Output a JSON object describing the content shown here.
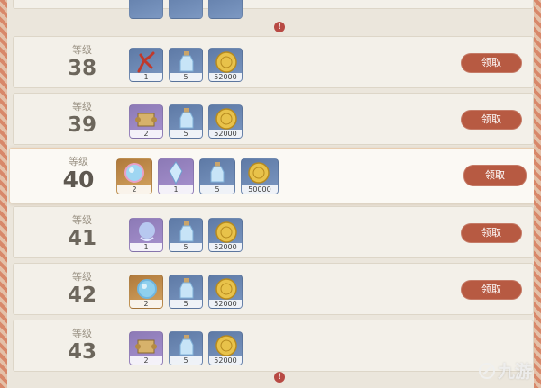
{
  "level_label": "等级",
  "claim_label": "领取",
  "rows": [
    {
      "level": "38",
      "items": [
        {
          "icon": "red-coral-icon",
          "quality": "blue",
          "count": "1"
        },
        {
          "icon": "potion-bottle-icon",
          "quality": "blue",
          "count": "5"
        },
        {
          "icon": "mora-coin-icon",
          "quality": "blue",
          "count": "52000"
        }
      ],
      "claimable": true
    },
    {
      "level": "39",
      "items": [
        {
          "icon": "scroll-icon",
          "quality": "purple",
          "count": "2"
        },
        {
          "icon": "potion-bottle-icon",
          "quality": "blue",
          "count": "5"
        },
        {
          "icon": "mora-coin-icon",
          "quality": "blue",
          "count": "52000"
        }
      ],
      "claimable": true
    },
    {
      "level": "40",
      "items": [
        {
          "icon": "crystal-orb-icon",
          "quality": "gold",
          "count": "2"
        },
        {
          "icon": "crystal-shard-icon",
          "quality": "purple",
          "count": "1"
        },
        {
          "icon": "potion-bottle-icon",
          "quality": "blue",
          "count": "5"
        },
        {
          "icon": "mora-coin-icon",
          "quality": "blue",
          "count": "50000"
        }
      ],
      "claimable": true
    },
    {
      "level": "41",
      "items": [
        {
          "icon": "crescent-orb-icon",
          "quality": "purple",
          "count": "1"
        },
        {
          "icon": "potion-bottle-icon",
          "quality": "blue",
          "count": "5"
        },
        {
          "icon": "mora-coin-icon",
          "quality": "blue",
          "count": "52000"
        }
      ],
      "claimable": true
    },
    {
      "level": "42",
      "items": [
        {
          "icon": "crystal-orb-icon",
          "quality": "gold",
          "count": "2"
        },
        {
          "icon": "potion-bottle-icon",
          "quality": "blue",
          "count": "5"
        },
        {
          "icon": "mora-coin-icon",
          "quality": "blue",
          "count": "52000"
        }
      ],
      "claimable": true
    },
    {
      "level": "43",
      "items": [
        {
          "icon": "scroll-icon",
          "quality": "purple",
          "count": "2"
        },
        {
          "icon": "potion-bottle-icon",
          "quality": "blue",
          "count": "5"
        },
        {
          "icon": "mora-coin-icon",
          "quality": "blue",
          "count": "52000"
        }
      ],
      "claimable": false
    }
  ],
  "watermark": {
    "text": "九游",
    "icon": "jiuyou-logo-icon"
  },
  "colors": {
    "claim_button": "#b75a42",
    "notice_dot": "#b84a44",
    "accent_border": "#d8886a"
  }
}
